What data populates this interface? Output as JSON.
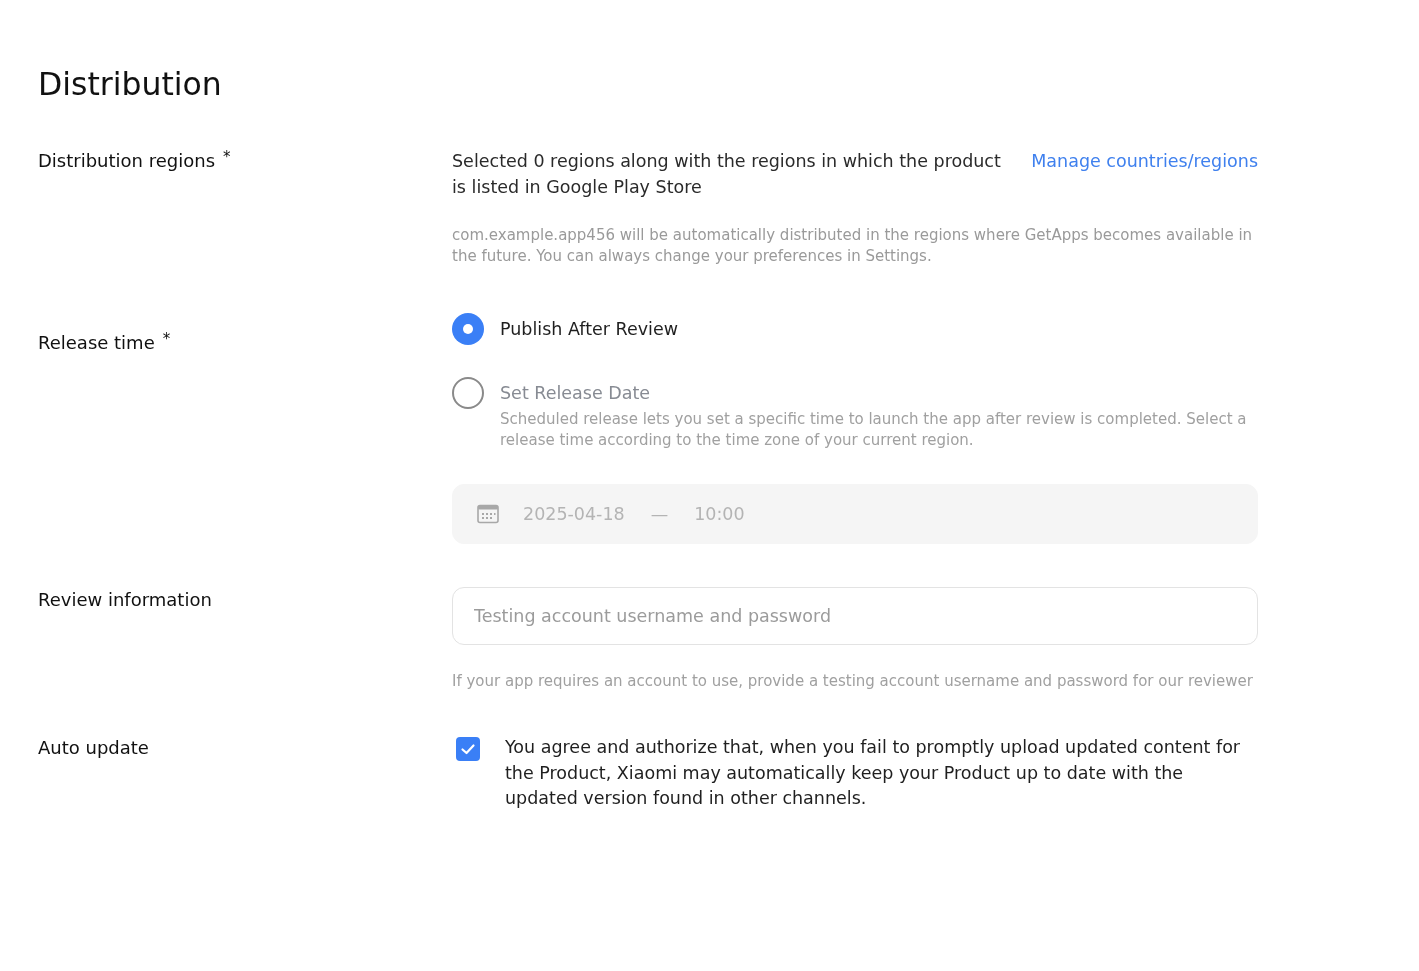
{
  "page_title": "Distribution",
  "sections": [
    {
      "kind": "regions",
      "label": "Distribution regions",
      "required_mark": "*",
      "summary": "Selected 0 regions along with the regions in which the product is listed in Google Play Store",
      "link": "Manage countries/regions",
      "note": "com.example.app456 will be automatically distributed in the regions where GetApps becomes available in the future. You can always change your preferences in Settings."
    },
    {
      "kind": "release",
      "label": "Release time",
      "required_mark": "*",
      "options": [
        {
          "label": "Publish After Review",
          "selected": true
        },
        {
          "label": "Set Release Date",
          "selected": false,
          "description": "Scheduled release lets you set a specific time to launch the app after review is completed. Select a release time according to the time zone of your current region."
        }
      ],
      "datetime": {
        "date": "2025-04-18",
        "separator": "—",
        "time": "10:00",
        "disabled": true
      }
    },
    {
      "kind": "review",
      "label": "Review information",
      "placeholder": "Testing account username and password",
      "hint": "If your app requires an account to use, provide a testing account username and password for our reviewer"
    },
    {
      "kind": "auto_update",
      "label": "Auto update",
      "checked": true,
      "text": "You agree and authorize that, when you fail to promptly upload updated content for the Product, Xiaomi may automatically keep your Product up to date with the updated version found in other channels."
    }
  ]
}
